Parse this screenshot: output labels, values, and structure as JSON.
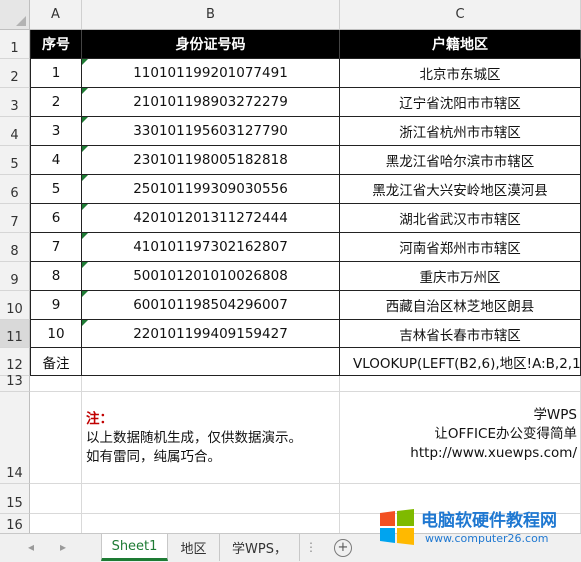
{
  "columns": [
    "A",
    "B",
    "C"
  ],
  "rows": [
    "1",
    "2",
    "3",
    "4",
    "5",
    "6",
    "7",
    "8",
    "9",
    "10",
    "11",
    "12",
    "13",
    "14",
    "15",
    "16"
  ],
  "table": {
    "headers": [
      "序号",
      "身份证号码",
      "户籍地区"
    ],
    "records": [
      {
        "no": "1",
        "id": "110101199201077491",
        "region": "北京市东城区"
      },
      {
        "no": "2",
        "id": "210101198903272279",
        "region": "辽宁省沈阳市市辖区"
      },
      {
        "no": "3",
        "id": "330101195603127790",
        "region": "浙江省杭州市市辖区"
      },
      {
        "no": "4",
        "id": "230101198005182818",
        "region": "黑龙江省哈尔滨市市辖区"
      },
      {
        "no": "5",
        "id": "250101199309030556",
        "region": "黑龙江省大兴安岭地区漠河县"
      },
      {
        "no": "6",
        "id": "420101201311272444",
        "region": "湖北省武汉市市辖区"
      },
      {
        "no": "7",
        "id": "410101197302162807",
        "region": "河南省郑州市市辖区"
      },
      {
        "no": "8",
        "id": "500101201010026808",
        "region": "重庆市万州区"
      },
      {
        "no": "9",
        "id": "600101198504296007",
        "region": "西藏自治区林芝地区朗县"
      },
      {
        "no": "10",
        "id": "220101199409159427",
        "region": "吉林省长春市市辖区"
      }
    ],
    "remark_label": "备注",
    "remark_b": "",
    "remark_formula": "VLOOKUP(LEFT(B2,6),地区!A:B,2,1"
  },
  "note": {
    "title": "注：",
    "line1": "以上数据随机生成，仅供数据演示。",
    "line2": "如有雷同，纯属巧合。"
  },
  "wps": {
    "line1": "学WPS",
    "line2": "让OFFICE办公变得简单",
    "line3": "http://www.xuewps.com/"
  },
  "tabs": {
    "nav_prev": "◂",
    "nav_next": "▸",
    "items": [
      "Sheet1",
      "地区",
      "学WPS，"
    ],
    "active": "Sheet1",
    "more": "⋮",
    "add": "+"
  },
  "watermark": {
    "title": "电脑软硬件教程网",
    "url": "www.computer26.com"
  },
  "colors": {
    "header_bg": "#000000",
    "note_red": "#c00000",
    "tab_active": "#1e7b34",
    "watermark_blue": "#1f78d1"
  }
}
